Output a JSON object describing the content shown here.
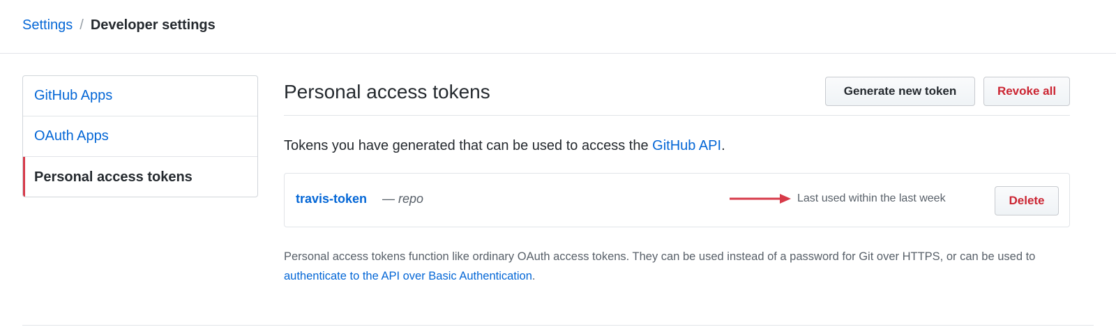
{
  "breadcrumb": {
    "root": "Settings",
    "separator": "/",
    "current": "Developer settings"
  },
  "sidebar": {
    "items": [
      {
        "label": "GitHub Apps",
        "selected": false
      },
      {
        "label": "OAuth Apps",
        "selected": false
      },
      {
        "label": "Personal access tokens",
        "selected": true
      }
    ]
  },
  "main": {
    "title": "Personal access tokens",
    "generate_label": "Generate new token",
    "revoke_label": "Revoke all",
    "intro_prefix": "Tokens you have generated that can be used to access the ",
    "intro_link": "GitHub API",
    "intro_suffix": "."
  },
  "tokens": [
    {
      "name": "travis-token",
      "scope": "— repo",
      "last_used": "Last used within the last week",
      "delete_label": "Delete"
    }
  ],
  "footnote": {
    "text": "Personal access tokens function like ordinary OAuth access tokens. They can be used instead of a password for Git over HTTPS, or can be used to ",
    "link": "authenticate to the API over Basic Authentication",
    "suffix": "."
  },
  "colors": {
    "link": "#0366d6",
    "danger": "#cb2431",
    "arrow": "#d73a49"
  },
  "icons": {
    "annotation": "red-arrow-icon"
  }
}
